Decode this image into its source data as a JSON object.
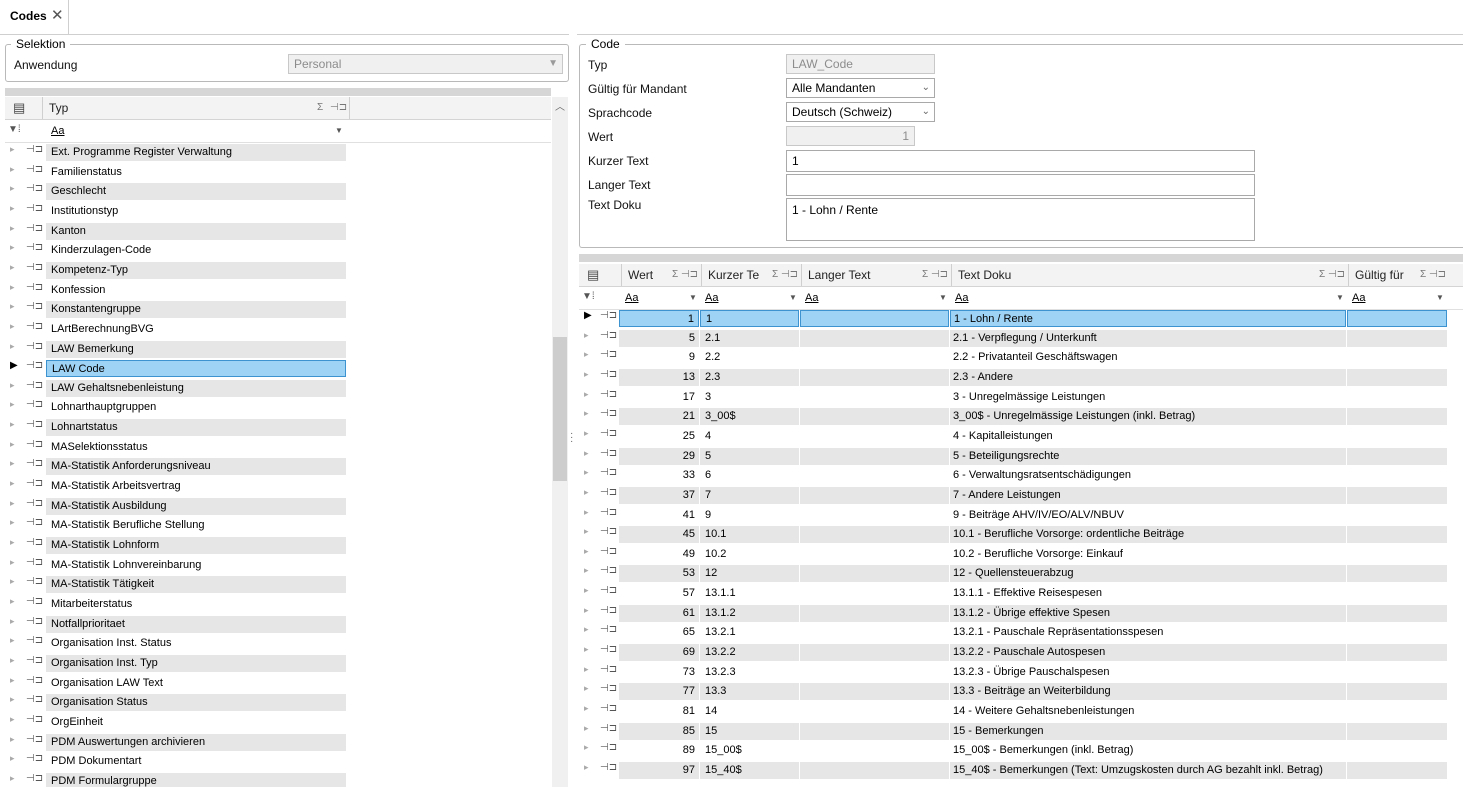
{
  "tabs": [
    {
      "label": "Codes",
      "close": "✕"
    }
  ],
  "selektion": {
    "legend": "Selektion",
    "anwendung_label": "Anwendung",
    "anwendung_value": "Personal"
  },
  "left_grid": {
    "header": "Typ",
    "filter_text": "Aa",
    "rows": [
      "Ext. Programme Register Verwaltung",
      "Familienstatus",
      "Geschlecht",
      "Institutionstyp",
      "Kanton",
      "Kinderzulagen-Code",
      "Kompetenz-Typ",
      "Konfession",
      "Konstantengruppe",
      "LArtBerechnungBVG",
      "LAW Bemerkung",
      "LAW Code",
      "LAW Gehaltsnebenleistung",
      "Lohnarthauptgruppen",
      "Lohnartstatus",
      "MASelektionsstatus",
      "MA-Statistik Anforderungsniveau",
      "MA-Statistik Arbeitsvertrag",
      "MA-Statistik Ausbildung",
      "MA-Statistik Berufliche Stellung",
      "MA-Statistik Lohnform",
      "MA-Statistik Lohnvereinbarung",
      "MA-Statistik Tätigkeit",
      "Mitarbeiterstatus",
      "Notfallprioritaet",
      "Organisation Inst. Status",
      "Organisation Inst. Typ",
      "Organisation LAW Text",
      "Organisation Status",
      "OrgEinheit",
      "PDM Auswertungen archivieren",
      "PDM Dokumentart",
      "PDM Formulargruppe"
    ],
    "selected_index": 11
  },
  "code": {
    "legend": "Code",
    "typ_label": "Typ",
    "typ_value": "LAW_Code",
    "mandant_label": "Gültig für Mandant",
    "mandant_value": "Alle Mandanten",
    "sprache_label": "Sprachcode",
    "sprache_value": "Deutsch (Schweiz)",
    "wert_label": "Wert",
    "wert_value": "1",
    "kurz_label": "Kurzer Text",
    "kurz_value": "1",
    "lang_label": "Langer Text",
    "lang_value": "",
    "doku_label": "Text Doku",
    "doku_value": "1 - Lohn / Rente"
  },
  "right_grid": {
    "columns": [
      "Wert",
      "Kurzer Te",
      "Langer Text",
      "Text Doku",
      "Gültig für"
    ],
    "filter_text": "Aa",
    "rows": [
      {
        "wert": "1",
        "kurz": "1",
        "lang": "",
        "doku": "1 - Lohn / Rente"
      },
      {
        "wert": "5",
        "kurz": "2.1",
        "lang": "",
        "doku": "2.1 - Verpflegung / Unterkunft"
      },
      {
        "wert": "9",
        "kurz": "2.2",
        "lang": "",
        "doku": "2.2 - Privatanteil Geschäftswagen"
      },
      {
        "wert": "13",
        "kurz": "2.3",
        "lang": "",
        "doku": "2.3 - Andere"
      },
      {
        "wert": "17",
        "kurz": "3",
        "lang": "",
        "doku": "3 - Unregelmässige Leistungen"
      },
      {
        "wert": "21",
        "kurz": "3_00$",
        "lang": "",
        "doku": "3_00$ - Unregelmässige Leistungen (inkl. Betrag)"
      },
      {
        "wert": "25",
        "kurz": "4",
        "lang": "",
        "doku": "4 - Kapitalleistungen"
      },
      {
        "wert": "29",
        "kurz": "5",
        "lang": "",
        "doku": "5 - Beteiligungsrechte"
      },
      {
        "wert": "33",
        "kurz": "6",
        "lang": "",
        "doku": "6 - Verwaltungsratsentschädigungen"
      },
      {
        "wert": "37",
        "kurz": "7",
        "lang": "",
        "doku": "7 - Andere Leistungen"
      },
      {
        "wert": "41",
        "kurz": "9",
        "lang": "",
        "doku": "9 - Beiträge AHV/IV/EO/ALV/NBUV"
      },
      {
        "wert": "45",
        "kurz": "10.1",
        "lang": "",
        "doku": "10.1 - Berufliche Vorsorge: ordentliche Beiträge"
      },
      {
        "wert": "49",
        "kurz": "10.2",
        "lang": "",
        "doku": "10.2 - Berufliche Vorsorge: Einkauf"
      },
      {
        "wert": "53",
        "kurz": "12",
        "lang": "",
        "doku": "12 - Quellensteuerabzug"
      },
      {
        "wert": "57",
        "kurz": "13.1.1",
        "lang": "",
        "doku": "13.1.1 - Effektive Reisespesen"
      },
      {
        "wert": "61",
        "kurz": "13.1.2",
        "lang": "",
        "doku": "13.1.2 - Übrige effektive Spesen"
      },
      {
        "wert": "65",
        "kurz": "13.2.1",
        "lang": "",
        "doku": "13.2.1 - Pauschale Repräsentationsspesen"
      },
      {
        "wert": "69",
        "kurz": "13.2.2",
        "lang": "",
        "doku": "13.2.2 - Pauschale Autospesen"
      },
      {
        "wert": "73",
        "kurz": "13.2.3",
        "lang": "",
        "doku": "13.2.3 - Übrige Pauschalspesen"
      },
      {
        "wert": "77",
        "kurz": "13.3",
        "lang": "",
        "doku": "13.3 - Beiträge an Weiterbildung"
      },
      {
        "wert": "81",
        "kurz": "14",
        "lang": "",
        "doku": "14 - Weitere Gehaltsnebenleistungen"
      },
      {
        "wert": "85",
        "kurz": "15",
        "lang": "",
        "doku": "15 - Bemerkungen"
      },
      {
        "wert": "89",
        "kurz": "15_00$",
        "lang": "",
        "doku": "15_00$ - Bemerkungen (inkl. Betrag)"
      },
      {
        "wert": "97",
        "kurz": "15_40$",
        "lang": "",
        "doku": "15_40$ - Bemerkungen (Text: Umzugskosten durch AG bezahlt inkl. Betrag)"
      }
    ],
    "selected_index": 0
  },
  "icons": {
    "column_chooser": "column-chooser-icon",
    "filter": "filter-icon",
    "sigma": "sigma-icon",
    "pin": "pin-icon",
    "row_pointer": "row-pointer-icon",
    "dropdown": "chevron-down-icon"
  },
  "colors": {
    "selection": "#9fd3f5",
    "selection_border": "#3c93d0",
    "alt_row": "#e6e6e6"
  }
}
